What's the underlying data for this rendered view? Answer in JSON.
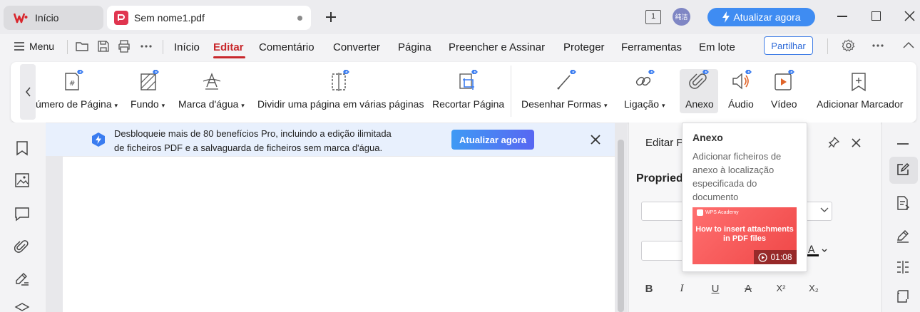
{
  "tabs": {
    "home_label": "Início",
    "doc_label": "Sem nome1.pdf"
  },
  "topbar": {
    "upgrade_label": "Atualizar agora",
    "avatar_text": "纯洁",
    "page_indicator": "1"
  },
  "menu": {
    "menu_label": "Menu",
    "items": [
      "Início",
      "Editar",
      "Comentário",
      "Converter",
      "Página",
      "Preencher e Assinar",
      "Proteger",
      "Ferramentas",
      "Em lote"
    ],
    "share_label": "Partilhar"
  },
  "ribbon": {
    "items": [
      {
        "label": "úmero de Página",
        "icon": "page-number-icon",
        "dropdown": true
      },
      {
        "label": "Fundo",
        "icon": "background-icon",
        "dropdown": true
      },
      {
        "label": "Marca d'água",
        "icon": "watermark-icon",
        "dropdown": true
      },
      {
        "label": "Dividir uma página em várias páginas",
        "icon": "split-page-icon",
        "dropdown": false
      },
      {
        "label": "Recortar Página",
        "icon": "crop-page-icon",
        "dropdown": false
      },
      {
        "label": "Desenhar Formas",
        "icon": "draw-shapes-icon",
        "dropdown": true
      },
      {
        "label": "Ligação",
        "icon": "link-icon",
        "dropdown": true
      },
      {
        "label": "Anexo",
        "icon": "attachment-icon",
        "dropdown": false
      },
      {
        "label": "Áudio",
        "icon": "audio-icon",
        "dropdown": false
      },
      {
        "label": "Vídeo",
        "icon": "video-icon",
        "dropdown": false
      },
      {
        "label": "Adicionar Marcador",
        "icon": "bookmark-add-icon",
        "dropdown": false
      }
    ]
  },
  "banner": {
    "text_line1": "Desbloqueie mais de 80 benefícios Pro, incluindo a edição ilimitada",
    "text_line2": "de ficheiros PDF e a salvaguarda de ficheiros sem marca d'água.",
    "button_label": "Atualizar agora"
  },
  "panel": {
    "title": "Editar P",
    "subtitle": "Propried",
    "format_buttons": [
      "B",
      "I",
      "U",
      "A",
      "X²",
      "X₂"
    ]
  },
  "tooltip": {
    "title": "Anexo",
    "description": "Adicionar ficheiros de anexo à localização especificada do documento",
    "thumb_brand": "WPS Academy",
    "thumb_headline": "How to insert attachments in PDF files",
    "thumb_duration": "01:08"
  },
  "colors": {
    "accent": "#c8282c",
    "upgrade_blue": "#3f8cf2",
    "badge_blue": "#3a7cf0"
  }
}
